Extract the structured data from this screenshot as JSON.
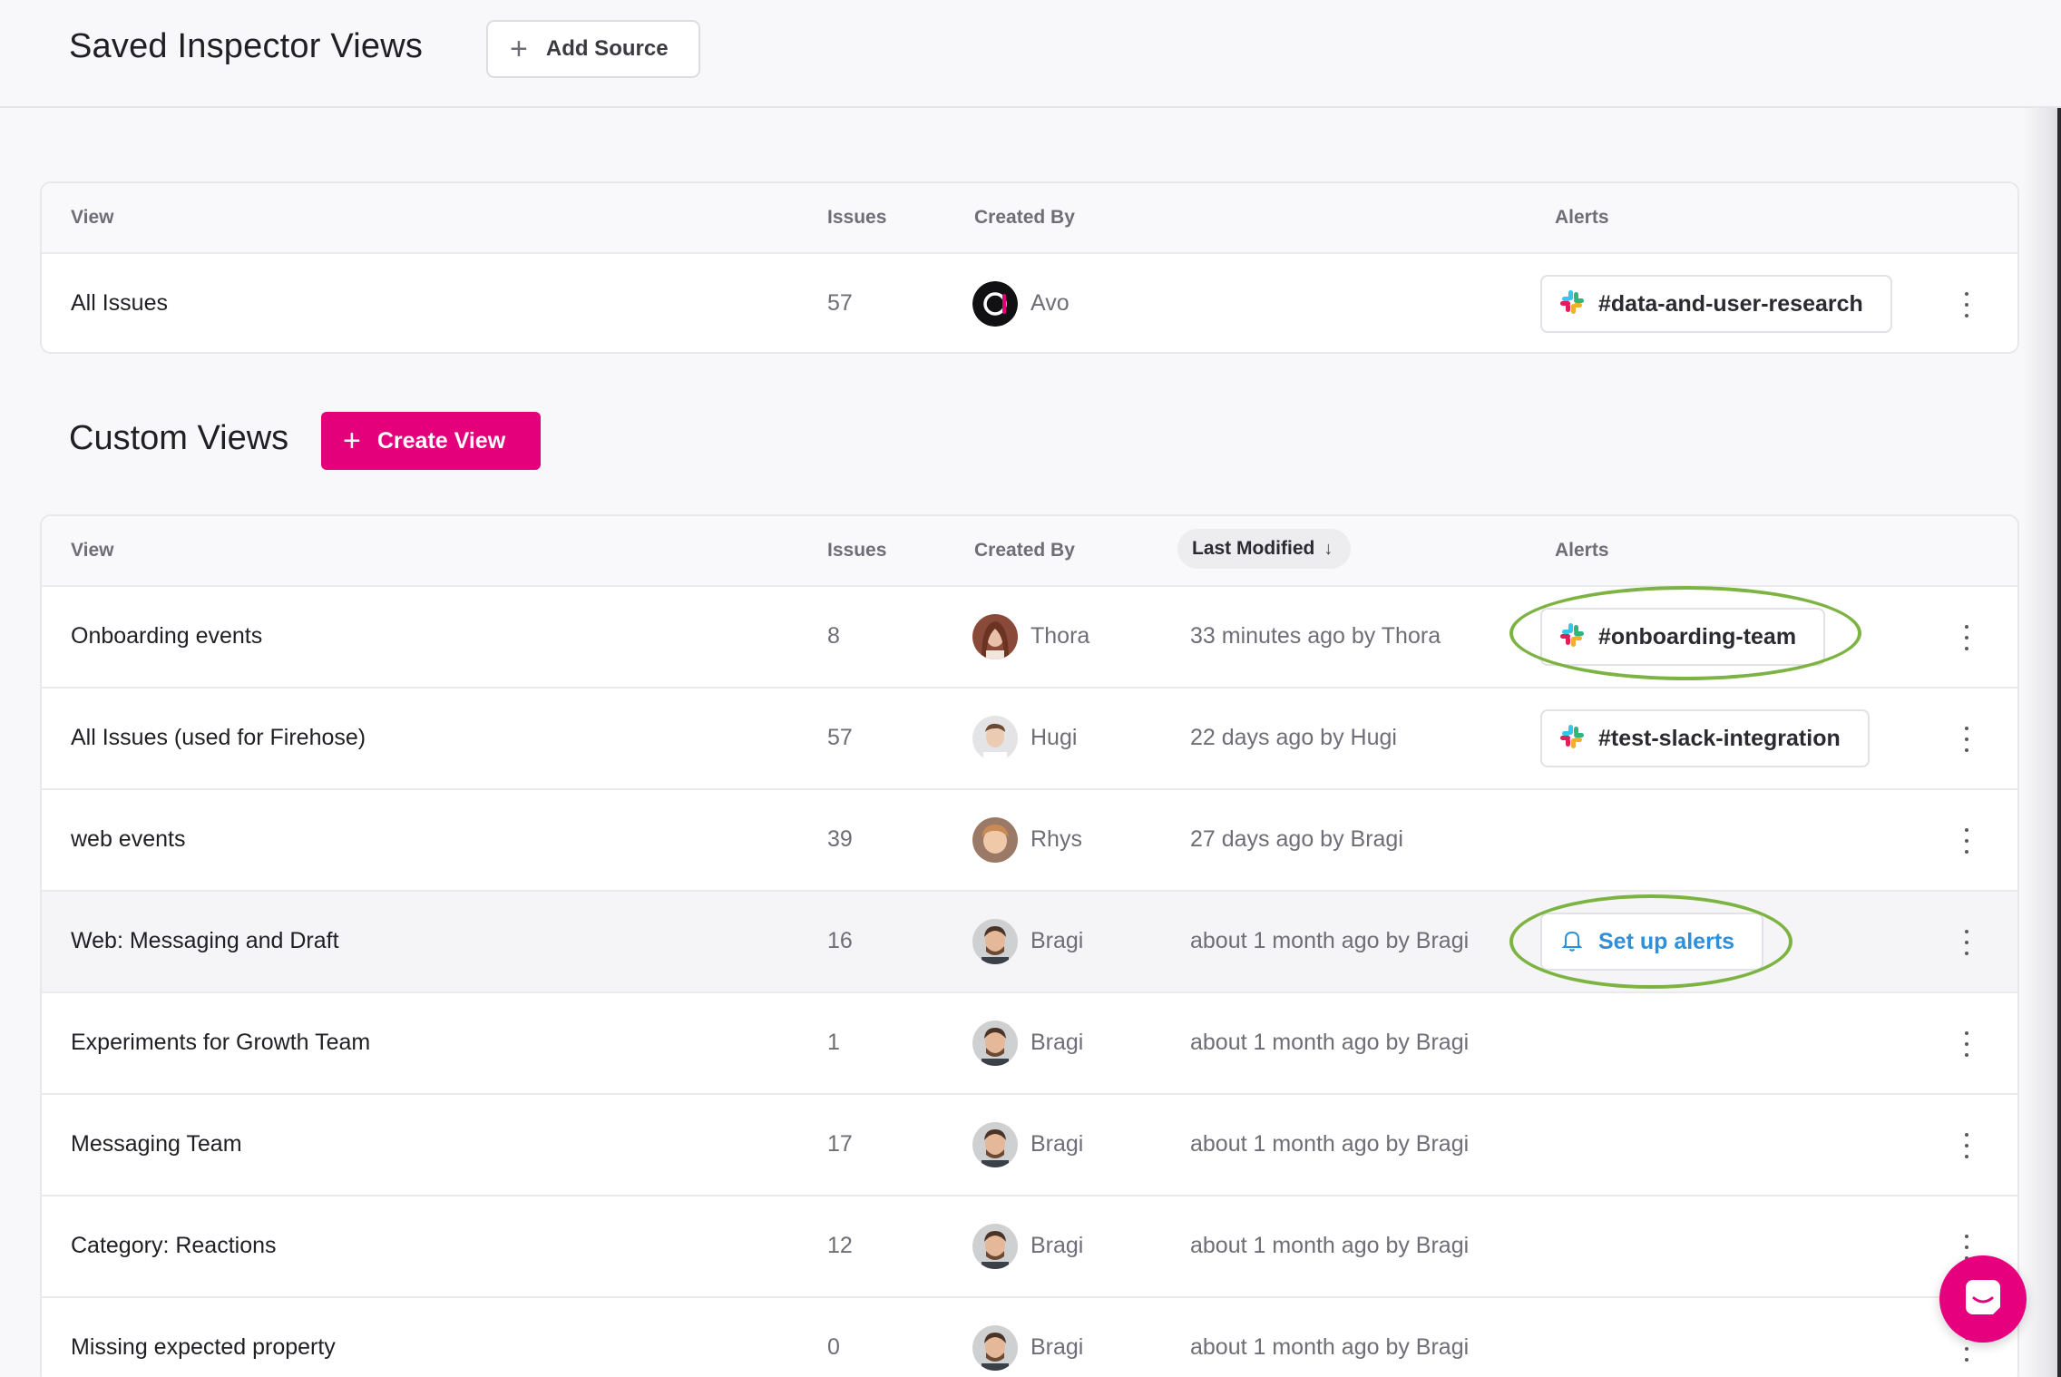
{
  "header": {
    "title": "Saved Inspector Views",
    "add_source_label": "Add Source"
  },
  "table_headers": {
    "view": "View",
    "issues": "Issues",
    "created_by": "Created By",
    "last_modified": "Last Modified",
    "alerts": "Alerts"
  },
  "all_issues": {
    "name": "All Issues",
    "issues": "57",
    "creator": "Avo",
    "alert": "#data-and-user-research"
  },
  "custom_views": {
    "title": "Custom Views",
    "create_label": "Create View",
    "rows": [
      {
        "name": "Onboarding events",
        "issues": "8",
        "creator": "Thora",
        "modified": "33 minutes ago by Thora",
        "alert": "#onboarding-team"
      },
      {
        "name": "All Issues (used for Firehose)",
        "issues": "57",
        "creator": "Hugi",
        "modified": "22 days ago by Hugi",
        "alert": "#test-slack-integration"
      },
      {
        "name": "web events",
        "issues": "39",
        "creator": "Rhys",
        "modified": "27 days ago by Bragi",
        "alert": ""
      },
      {
        "name": "Web: Messaging and Draft",
        "issues": "16",
        "creator": "Bragi",
        "modified": "about 1 month ago by Bragi",
        "alert": "Set up alerts"
      },
      {
        "name": "Experiments for Growth Team",
        "issues": "1",
        "creator": "Bragi",
        "modified": "about 1 month ago by Bragi",
        "alert": ""
      },
      {
        "name": "Messaging Team",
        "issues": "17",
        "creator": "Bragi",
        "modified": "about 1 month ago by Bragi",
        "alert": ""
      },
      {
        "name": "Category: Reactions",
        "issues": "12",
        "creator": "Bragi",
        "modified": "about 1 month ago by Bragi",
        "alert": ""
      },
      {
        "name": "Missing expected property",
        "issues": "0",
        "creator": "Bragi",
        "modified": "about 1 month ago by Bragi",
        "alert": ""
      }
    ]
  },
  "icons": {
    "plus": "plus-icon",
    "slack": "slack-icon",
    "bell": "bell-icon",
    "kebab": "kebab-menu-icon",
    "sort": "arrow-down-icon",
    "chat": "chat-icon"
  },
  "colors": {
    "brand_pink": "#e3007a",
    "link_blue": "#2f8fd8",
    "highlight_green": "#7cb342"
  }
}
